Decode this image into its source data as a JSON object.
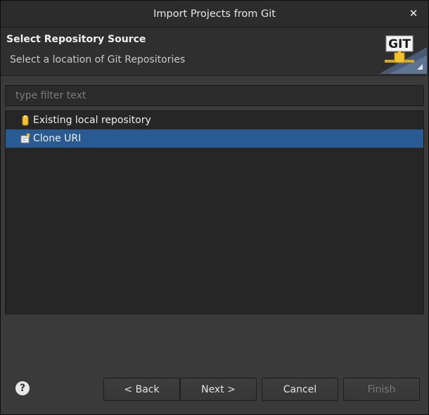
{
  "window": {
    "title": "Import Projects from Git",
    "close_glyph": "✕"
  },
  "banner": {
    "title": "Select Repository Source",
    "description": "Select a location of Git Repositories",
    "logo_text": "GIT",
    "logo_icon": "git-logo-icon"
  },
  "filter": {
    "value": "",
    "placeholder": "type filter text"
  },
  "tree": {
    "items": [
      {
        "label": "Existing local repository",
        "icon": "repository-icon",
        "selected": false
      },
      {
        "label": "Clone URI",
        "icon": "clone-uri-icon",
        "selected": true
      }
    ]
  },
  "buttons": {
    "help": "?",
    "back": "< Back",
    "next": "Next >",
    "cancel": "Cancel",
    "finish": "Finish"
  },
  "colors": {
    "selection": "#2a5a92",
    "dialog_bg": "#3a3a3a",
    "list_bg": "#262626",
    "git_logo_accent": "#f2c230"
  }
}
